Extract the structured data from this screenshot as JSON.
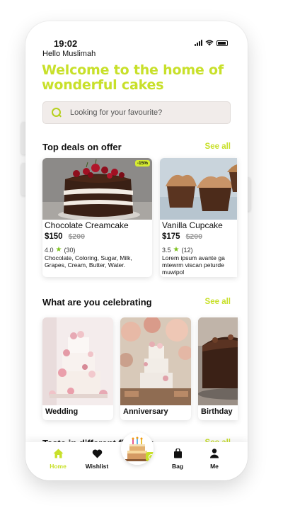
{
  "status": {
    "time": "19:02"
  },
  "header": {
    "greeting": "Hello Muslimah",
    "headline": "Welcome to the home of wonderful cakes"
  },
  "search": {
    "placeholder": "Looking for your favourite?"
  },
  "deals": {
    "title": "Top deals on offer",
    "see_all": "See all",
    "items": [
      {
        "name": "Chocolate Creamcake",
        "price": "$150",
        "old_price": "$200",
        "rating": "4.0",
        "reviews": "(30)",
        "description": "Chocolate, Coloring, Sugar, Milk, Grapes, Cream, Butter, Water.",
        "badge": "-15%"
      },
      {
        "name": "Vanilla Cupcake",
        "price": "$175",
        "old_price": "$200",
        "rating": "3.5",
        "reviews": "(12)",
        "description": "Lorem ipsum avante ga mtewrm viscan peturde muwipol"
      }
    ]
  },
  "celebrating": {
    "title": "What are you celebrating",
    "see_all": "See all",
    "items": [
      {
        "label": "Wedding"
      },
      {
        "label": "Anniversary"
      },
      {
        "label": "Birthday"
      }
    ]
  },
  "taste": {
    "title": "Taste in different flavours",
    "see_all": "See all"
  },
  "nav": {
    "items": [
      {
        "label": "Home",
        "icon": "home-icon",
        "active": true
      },
      {
        "label": "Wishlist",
        "icon": "heart-icon"
      },
      {
        "label": "Bag",
        "icon": "bag-icon"
      },
      {
        "label": "Me",
        "icon": "person-icon"
      }
    ]
  },
  "colors": {
    "accent": "#c8e02a",
    "text": "#111111",
    "search_bg": "#f1ecea"
  }
}
